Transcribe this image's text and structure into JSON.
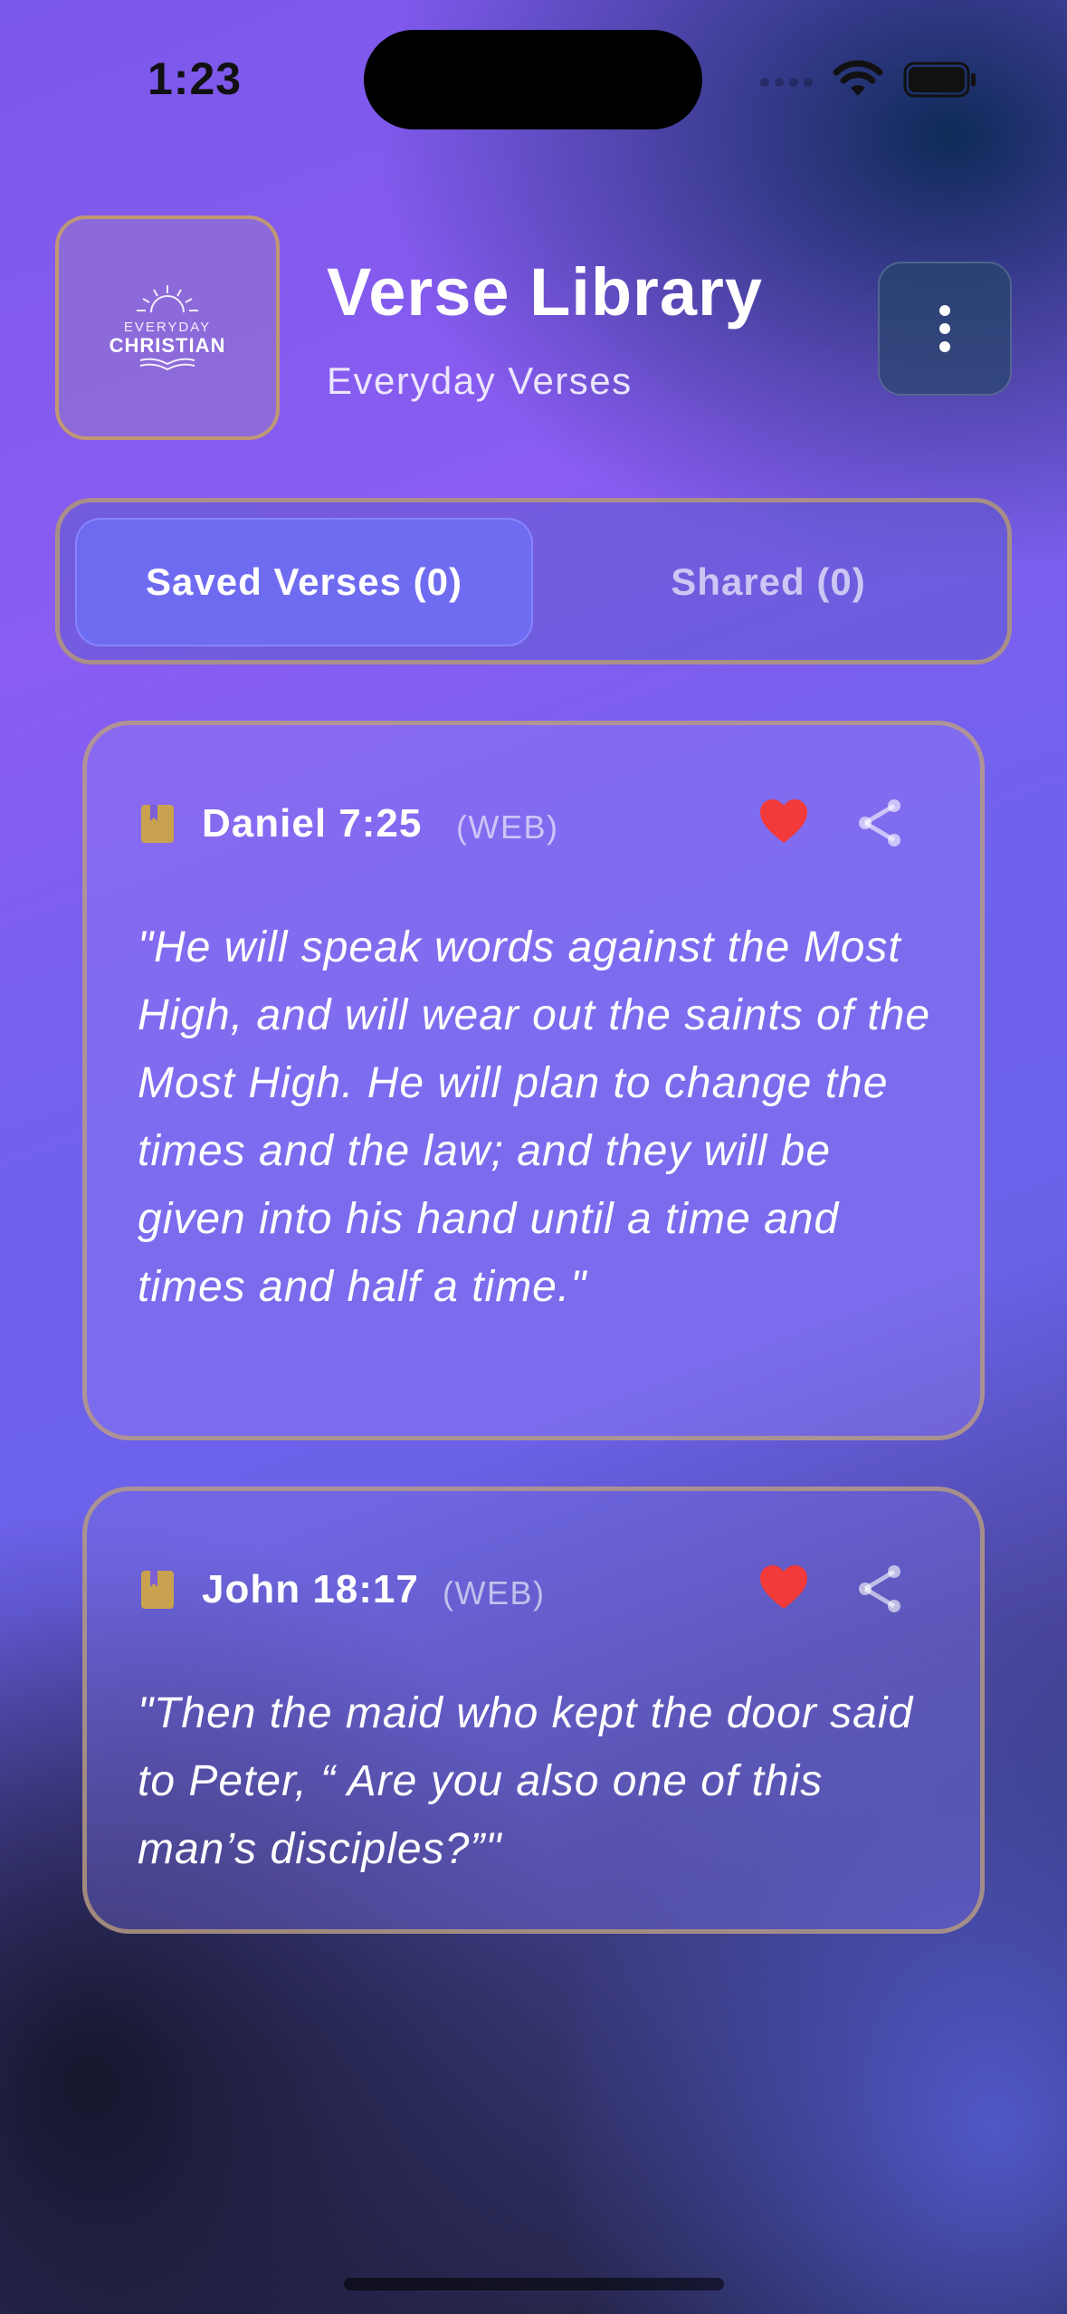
{
  "status_bar": {
    "time": "1:23"
  },
  "header": {
    "logo_top": "EVERYDAY",
    "logo_main": "CHRISTIAN",
    "title": "Verse Library",
    "subtitle": "Everyday Verses"
  },
  "tabs": [
    {
      "label": "Saved Verses (0)",
      "selected": true
    },
    {
      "label": "Shared (0)",
      "selected": false
    }
  ],
  "verses": [
    {
      "reference": "Daniel 7:25",
      "translation": "(WEB)",
      "text": "\"He will speak words against the Most High, and will wear out the saints of the Most High. He will plan to change the times and the law; and they will be given into his hand until a time and times and half a time.\"",
      "favorited": true
    },
    {
      "reference": "John 18:17",
      "translation": "(WEB)",
      "text": "\"Then the maid who kept the door said to Peter, “ Are you also one of this man’s disciples?”\"",
      "favorited": true
    }
  ],
  "colors": {
    "accent_gold": "#cda55a",
    "heart_red": "#f23a3a",
    "book_gold": "#c9a24f"
  },
  "icons": {
    "wifi": "wifi-icon",
    "battery": "battery-icon",
    "menu": "more-vertical-icon",
    "book": "book-icon",
    "favorite": "heart-icon",
    "share": "share-icon"
  }
}
